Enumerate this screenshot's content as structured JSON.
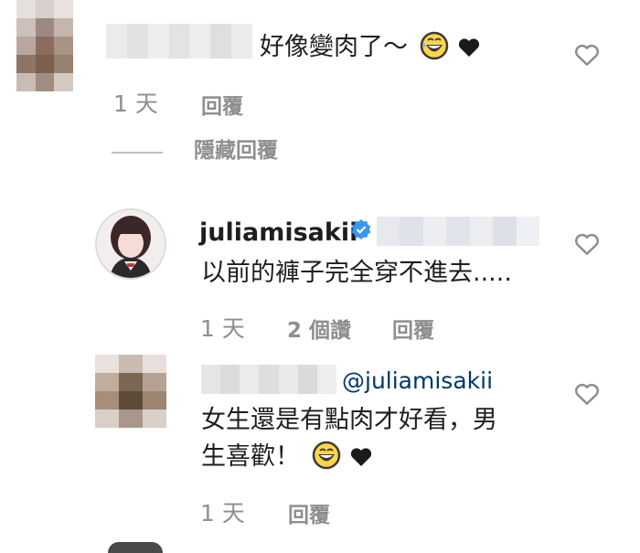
{
  "comments": [
    {
      "text": "好像變肉了～",
      "time": "1 天",
      "reply_label": "回覆",
      "hide_replies_label": "隱藏回覆"
    },
    {
      "username": "juliamisakii",
      "text": "以前的褲子完全穿不進去.....",
      "time": "1 天",
      "likes": "2 個讚",
      "reply_label": "回覆"
    },
    {
      "mention": "@juliamisakii",
      "text_line1": "女生還是有點肉才好看，男",
      "text_line2": "生喜歡！",
      "time": "1 天",
      "reply_label": "回覆"
    }
  ],
  "colors": {
    "secondary_text": "#8e8e8e",
    "mention": "#00376b",
    "verified": "#3897f0"
  },
  "icons": [
    "heart-outline-icon",
    "verified-badge-icon",
    "grinning-sweat-emoji-icon",
    "grinning-emoji-icon",
    "black-heart-icon"
  ]
}
